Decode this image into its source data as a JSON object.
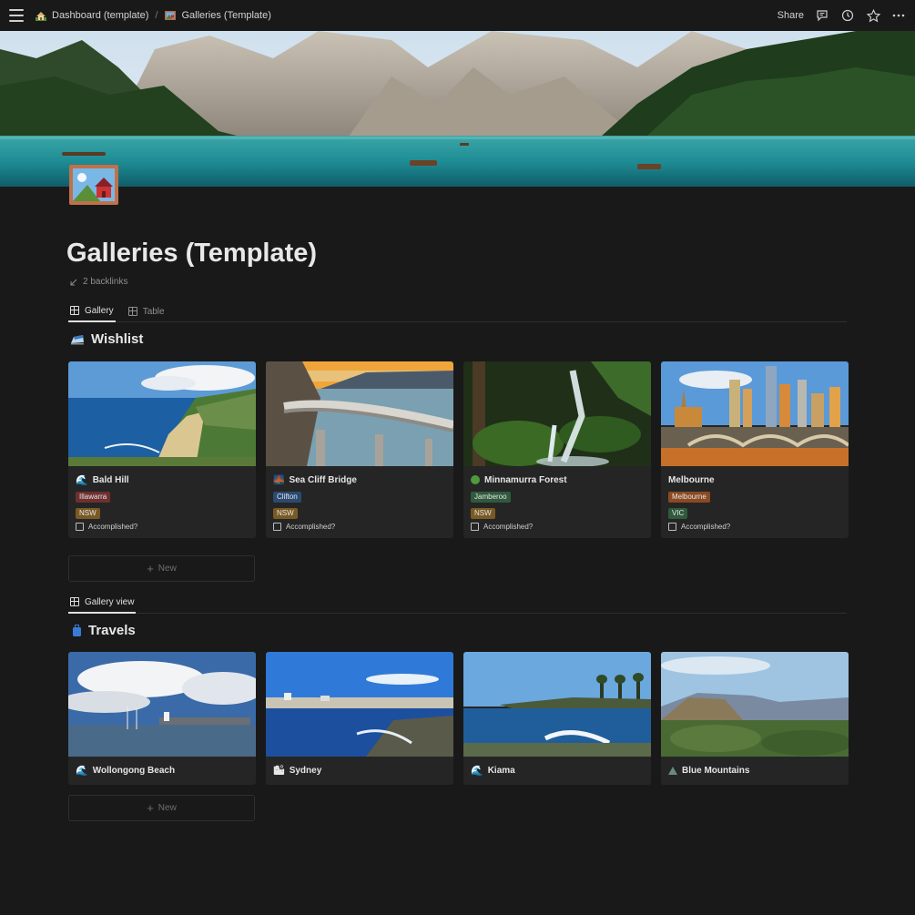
{
  "topbar": {
    "crumbs": [
      "Dashboard (template)",
      "Galleries (Template)"
    ],
    "separator": "/",
    "share_label": "Share"
  },
  "page": {
    "title": "Galleries (Template)",
    "backlinks": "2 backlinks"
  },
  "tabs": [
    {
      "label": "Gallery",
      "active": true
    },
    {
      "label": "Table",
      "active": false
    }
  ],
  "wishlist": {
    "title": "Wishlist",
    "cards": [
      {
        "name": "Bald Hill",
        "icon": "wave-icon",
        "tags": [
          {
            "text": "Illawarra",
            "color": "#6e2f2f"
          },
          {
            "text": "NSW",
            "color": "#7a5a24"
          }
        ],
        "check_label": "Accomplished?"
      },
      {
        "name": "Sea Cliff Bridge",
        "icon": "bridge-icon",
        "tags": [
          {
            "text": "Clifton",
            "color": "#2a4a72"
          },
          {
            "text": "NSW",
            "color": "#7a5a24"
          }
        ],
        "check_label": "Accomplished?"
      },
      {
        "name": "Minnamurra Forest",
        "icon": "green-circle-icon",
        "tags": [
          {
            "text": "Jamberoo",
            "color": "#2f5a3c"
          },
          {
            "text": "NSW",
            "color": "#7a5a24"
          }
        ],
        "check_label": "Accomplished?"
      },
      {
        "name": "Melbourne",
        "icon": "",
        "tags": [
          {
            "text": "Melbourne",
            "color": "#8a4a22"
          },
          {
            "text": "VIC",
            "color": "#2f5a3c"
          }
        ],
        "check_label": "Accomplished?"
      }
    ],
    "new_label": "New"
  },
  "gallery_view_tab": "Gallery view",
  "travels": {
    "title": "Travels",
    "cards": [
      {
        "name": "Wollongong Beach",
        "icon": "wave-icon"
      },
      {
        "name": "Sydney",
        "icon": "city-icon"
      },
      {
        "name": "Kiama",
        "icon": "wave-icon"
      },
      {
        "name": "Blue Mountains",
        "icon": "mountain-icon"
      }
    ],
    "new_label": "New"
  }
}
